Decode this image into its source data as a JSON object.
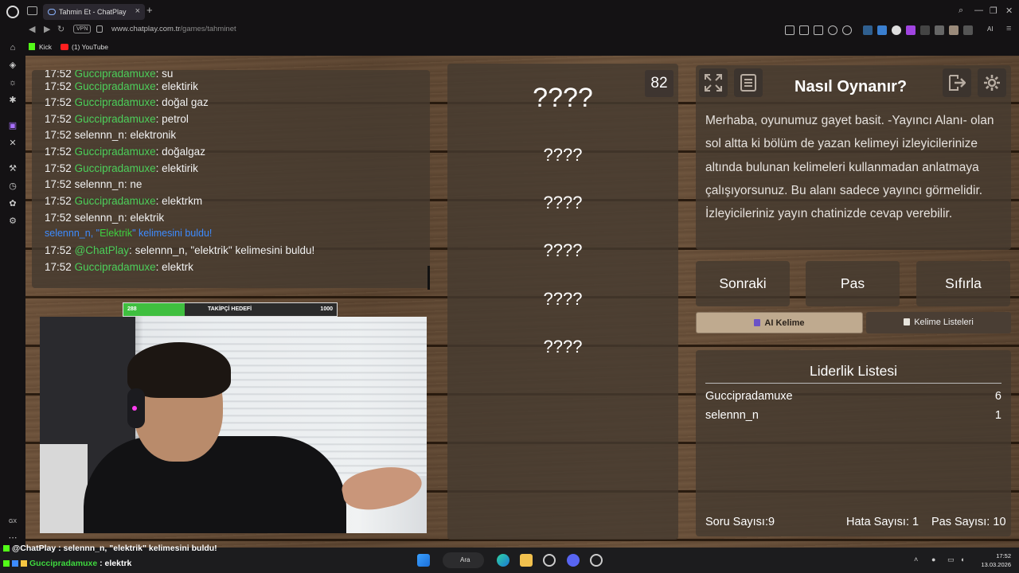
{
  "browser": {
    "tab_title": "Tahmin Et - ChatPlay",
    "url_domain": "www.chatplay.com.tr",
    "url_path": "/games/tahminet",
    "vpn_label": "VPN",
    "ai_label": "AI",
    "bookmarks": [
      {
        "label": "Kick",
        "icon": "kick-icon"
      },
      {
        "label": "(1) YouTube",
        "icon": "youtube-icon"
      }
    ],
    "sidebar_footer": "GX"
  },
  "chat": {
    "messages": [
      {
        "time": "17:52",
        "user": "Guccipradamuxe",
        "sep": ": ",
        "text": "su"
      },
      {
        "time": "17:52",
        "user": "Guccipradamuxe",
        "sep": ": ",
        "text": "elektirik"
      },
      {
        "time": "17:52",
        "user": "Guccipradamuxe",
        "sep": ": ",
        "text": "doğal gaz"
      },
      {
        "time": "17:52",
        "user": "Guccipradamuxe",
        "sep": ": ",
        "text": "petrol"
      },
      {
        "time": "17:52",
        "user": "selennn_n",
        "sep": ": ",
        "text": "elektronik"
      },
      {
        "time": "17:52",
        "user": "Guccipradamuxe",
        "sep": ": ",
        "text": "doğalgaz"
      },
      {
        "time": "17:52",
        "user": "Guccipradamuxe",
        "sep": ": ",
        "text": "elektirik"
      },
      {
        "time": "17:52",
        "user": "selennn_n",
        "sep": ": ",
        "text": "ne"
      },
      {
        "time": "17:52",
        "user": "Guccipradamuxe",
        "sep": ": ",
        "text": "elektrkm"
      },
      {
        "time": "17:52",
        "user": "selennn_n",
        "sep": ": ",
        "text": "elektrik"
      },
      {
        "system_pre": "selennn_n, \"",
        "system_word": "Elektrik",
        "system_post": "\" kelimesini buldu!"
      },
      {
        "time": "17:52",
        "user": "@ChatPlay",
        "sep": ": ",
        "text": "selennn_n, \"elektrik\" kelimesini buldu!"
      },
      {
        "time": "17:52",
        "user": "Guccipradamuxe",
        "sep": ": ",
        "text": "elektrk"
      }
    ]
  },
  "follower_goal": {
    "current": "288",
    "label": "TAKİPÇİ HEDEFİ",
    "target": "1000",
    "progress": 0.288
  },
  "word_panel": {
    "timer": "82",
    "slots": [
      "????",
      "????",
      "????",
      "????",
      "????",
      "????"
    ]
  },
  "howto": {
    "title": "Nasıl Oynanır?",
    "text": "Merhaba, oyunumuz gayet basit. -Yayıncı Alanı- olan sol altta ki bölüm de yazan kelimeyi izleyicilerinize altında bulunan kelimeleri kullanmadan anlatmaya çalışıyorsunuz. Bu alanı sadece yayıncı görmelidir. İzleyicileriniz yayın chatinizde cevap verebilir."
  },
  "buttons": {
    "next": "Sonraki",
    "pass": "Pas",
    "reset": "Sıfırla",
    "ai_word": "AI Kelime",
    "word_lists": "Kelime Listeleri"
  },
  "leaderboard": {
    "title": "Liderlik Listesi",
    "rows": [
      {
        "name": "Guccipradamuxe",
        "score": "6"
      },
      {
        "name": "selennn_n",
        "score": "1"
      }
    ],
    "question_count_label": "Soru Sayısı:",
    "question_count": "9",
    "error_count_label": "Hata Sayısı:",
    "error_count": "1",
    "pass_count_label": "Pas Sayısı:",
    "pass_count": "10"
  },
  "overlay_chat": [
    {
      "user": "@ChatPlay",
      "text": " : selennn_n, \"elektrik\" kelimesini buldu!"
    },
    {
      "user": "Guccipradamuxe",
      "text": " : elektrk"
    }
  ],
  "taskbar": {
    "search_label": "Ara",
    "time": "17:52",
    "date": "13.03.2026"
  },
  "colors": {
    "chat_user": "#4ccf5a",
    "system_message": "#3d8bff",
    "goal_fill": "#3fbf3f",
    "panel": "#463a30"
  }
}
